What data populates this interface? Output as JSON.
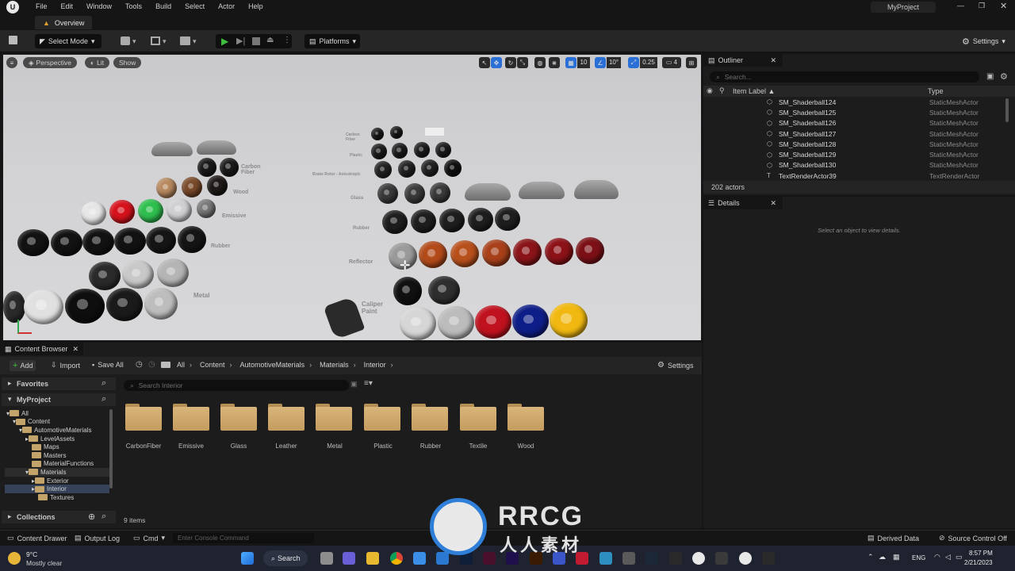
{
  "menu": [
    "File",
    "Edit",
    "Window",
    "Tools",
    "Build",
    "Select",
    "Actor",
    "Help"
  ],
  "project_name": "MyProject",
  "level_tab": "Overview",
  "toolbar": {
    "select_mode": "Select Mode",
    "platforms": "Platforms",
    "settings": "Settings"
  },
  "viewport": {
    "perspective": "Perspective",
    "lit": "Lit",
    "show": "Show",
    "grid_size": "10",
    "rotation_snap": "10°",
    "scale_snap": "0.25",
    "camera_speed": "4",
    "labels": {
      "carbon_fiber": "Carbon Fiber",
      "wood": "Wood",
      "emissive": "Emissive",
      "rubber_left": "Rubber",
      "metal": "Metal",
      "carbon_fiber_right": "Carbon Fiber",
      "plastic": "Plastic",
      "brake_rotor": "Brake Rotor - Anisotropic",
      "glass": "Glass",
      "rubber_right": "Rubber",
      "reflector": "Reflector",
      "caliper_paint": "Caliper Paint"
    }
  },
  "outliner": {
    "title": "Outliner",
    "search_placeholder": "Search...",
    "col_label": "Item Label ▲",
    "col_type": "Type",
    "rows": [
      {
        "name": "SM_Shaderball124",
        "type": "StaticMeshActor"
      },
      {
        "name": "SM_Shaderball125",
        "type": "StaticMeshActor"
      },
      {
        "name": "SM_Shaderball126",
        "type": "StaticMeshActor"
      },
      {
        "name": "SM_Shaderball127",
        "type": "StaticMeshActor"
      },
      {
        "name": "SM_Shaderball128",
        "type": "StaticMeshActor"
      },
      {
        "name": "SM_Shaderball129",
        "type": "StaticMeshActor"
      },
      {
        "name": "SM_Shaderball130",
        "type": "StaticMeshActor"
      },
      {
        "name": "TextRenderActor39",
        "type": "TextRenderActor"
      }
    ],
    "count": "202 actors"
  },
  "details": {
    "title": "Details",
    "empty_message": "Select an object to view details."
  },
  "content_browser": {
    "title": "Content Browser",
    "add": "Add",
    "import": "Import",
    "save_all": "Save All",
    "breadcrumbs": [
      "All",
      "Content",
      "AutomotiveMaterials",
      "Materials",
      "Interior"
    ],
    "settings": "Settings",
    "favorites": "Favorites",
    "project": "MyProject",
    "search_placeholder": "Search Interior",
    "tree": [
      {
        "label": "All",
        "depth": 0
      },
      {
        "label": "Content",
        "depth": 1
      },
      {
        "label": "AutomotiveMaterials",
        "depth": 2
      },
      {
        "label": "LevelAssets",
        "depth": 3
      },
      {
        "label": "Maps",
        "depth": 3
      },
      {
        "label": "Masters",
        "depth": 3
      },
      {
        "label": "MaterialFunctions",
        "depth": 3
      },
      {
        "label": "Materials",
        "depth": 3
      },
      {
        "label": "Exterior",
        "depth": 4
      },
      {
        "label": "Interior",
        "depth": 4
      },
      {
        "label": "Textures",
        "depth": 4
      }
    ],
    "collections": "Collections",
    "folders": [
      "CarbonFiber",
      "Emissive",
      "Glass",
      "Leather",
      "Metal",
      "Plastic",
      "Rubber",
      "Textile",
      "Wood"
    ],
    "item_count": "9 items"
  },
  "statusbar": {
    "content_drawer": "Content Drawer",
    "output_log": "Output Log",
    "cmd": "Cmd",
    "console_placeholder": "Enter Console Command",
    "derived_data": "Derived Data",
    "source_control": "Source Control Off"
  },
  "taskbar": {
    "weather_temp": "9°C",
    "weather_desc": "Mostly clear",
    "search": "Search",
    "lang": "ENG",
    "time": "8:57 PM",
    "date": "2/21/2023"
  },
  "watermark": {
    "brand": "RRCG",
    "sub": "人人素材"
  },
  "colors": {
    "accent_blue": "#2a6fd6",
    "play_green": "#3fbf3f",
    "folder": "#c9a567"
  }
}
